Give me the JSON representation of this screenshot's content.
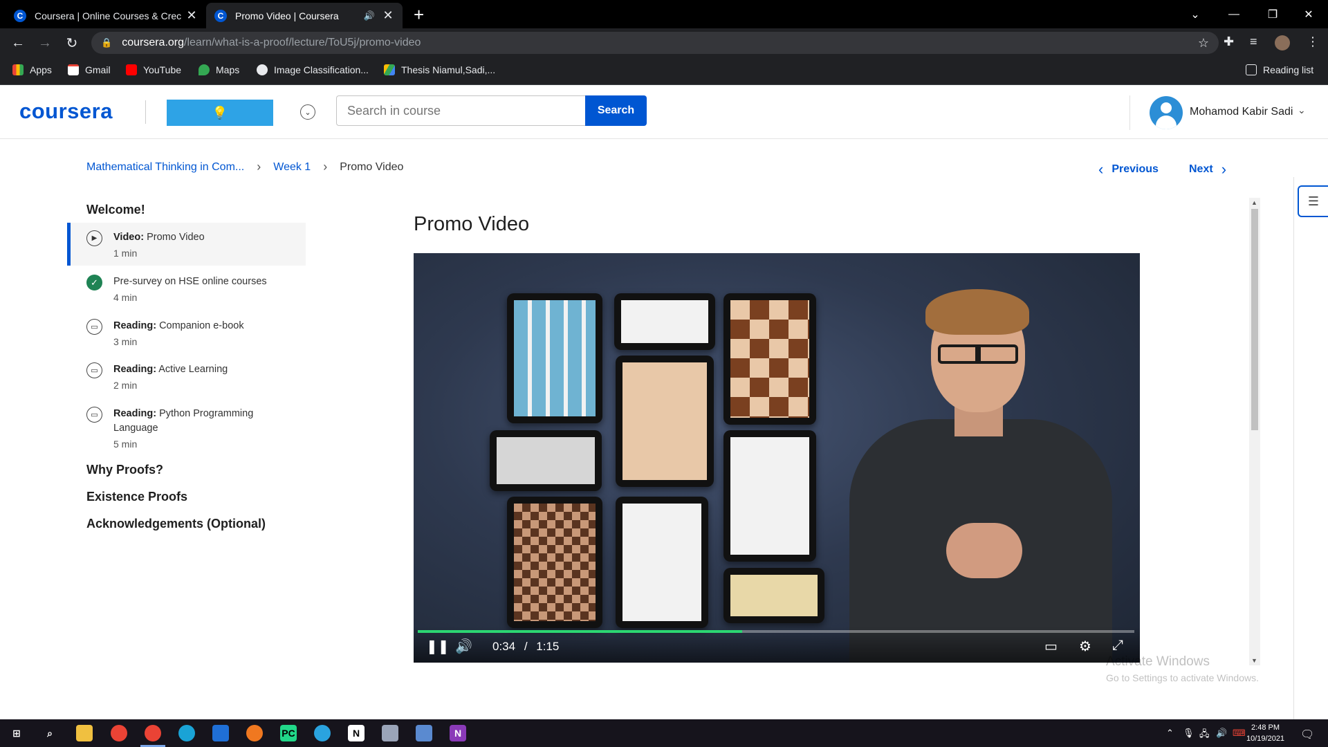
{
  "browser": {
    "tabs": [
      {
        "title": "Coursera | Online Courses & Crec",
        "active": false
      },
      {
        "title": "Promo Video | Coursera",
        "active": true
      }
    ],
    "url_host": "coursera.org",
    "url_path": "/learn/what-is-a-proof/lecture/ToU5j/promo-video",
    "bookmarks": [
      "Apps",
      "Gmail",
      "YouTube",
      "Maps",
      "Image Classification...",
      "Thesis Niamul,Sadi,..."
    ],
    "reading_list": "Reading list"
  },
  "header": {
    "logo": "coursera",
    "search_placeholder": "Search in course",
    "search_button": "Search",
    "user_name": "Mohamod Kabir Sadi"
  },
  "breadcrumb": {
    "course": "Mathematical Thinking in Com...",
    "week": "Week 1",
    "current": "Promo Video",
    "previous": "Previous",
    "next": "Next"
  },
  "sidebar": {
    "section_welcome": "Welcome!",
    "items": [
      {
        "type": "Video:",
        "title": "Promo Video",
        "duration": "1 min",
        "icon": "play-icon"
      },
      {
        "type": "",
        "title": "Pre-survey on HSE online courses",
        "duration": "4 min",
        "icon": "checkmark-icon"
      },
      {
        "type": "Reading:",
        "title": "Companion e-book",
        "duration": "3 min",
        "icon": "book-icon"
      },
      {
        "type": "Reading:",
        "title": "Active Learning",
        "duration": "2 min",
        "icon": "book-icon"
      },
      {
        "type": "Reading:",
        "title": "Python Programming Language",
        "duration": "5 min",
        "icon": "book-icon"
      }
    ],
    "sections": [
      "Why Proofs?",
      "Existence Proofs",
      "Acknowledgements (Optional)"
    ]
  },
  "main": {
    "title": "Promo Video",
    "video": {
      "current_time": "0:34",
      "separator": "/",
      "duration": "1:15",
      "progress": 0.453
    }
  },
  "watermark": {
    "line1": "Activate Windows",
    "line2": "Go to Settings to activate Windows."
  },
  "taskbar": {
    "time": "2:48 PM",
    "date": "10/19/2021"
  },
  "colors": {
    "brand": "#0056d2",
    "progress": "#2cd672",
    "complete": "#1f8354"
  }
}
